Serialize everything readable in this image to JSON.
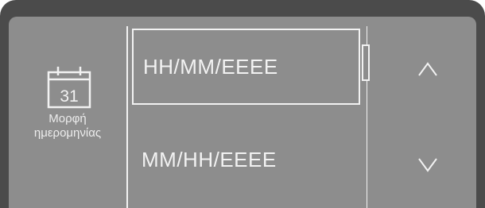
{
  "sidebar": {
    "icon": "calendar-icon",
    "calendar_day": "31",
    "label_line1": "Μορφή",
    "label_line2": "ημερομηνίας"
  },
  "options": [
    {
      "label": "HH/MM/EEEE",
      "selected": true
    },
    {
      "label": "MM/HH/EEEE",
      "selected": false
    }
  ],
  "navigation": {
    "up_icon": "chevron-up-icon",
    "down_icon": "chevron-down-icon"
  },
  "colors": {
    "screen_background": "#8d8d8d",
    "bezel": "#4b4b4b",
    "foreground": "#f2f2f2"
  }
}
